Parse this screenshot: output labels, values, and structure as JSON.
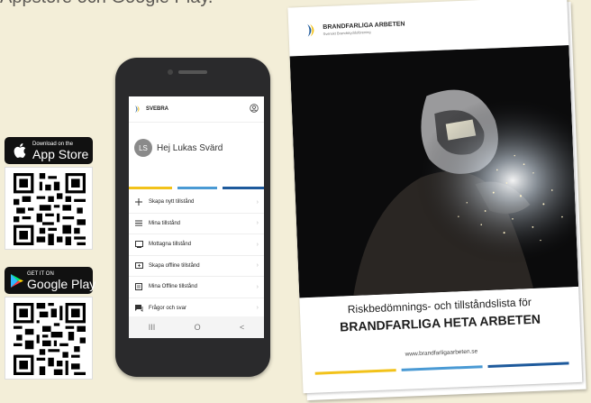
{
  "headline": "Appstore och Google Play.",
  "app_store_badge": {
    "small": "Download on the",
    "big": "App Store"
  },
  "google_play_badge": {
    "small": "GET IT ON",
    "big": "Google Play"
  },
  "phone": {
    "brand": "SVEBRA",
    "avatar_initials": "LS",
    "greeting": "Hej Lukas Svärd",
    "menu": [
      {
        "icon": "plus-icon",
        "label": "Skapa nytt tillstånd"
      },
      {
        "icon": "list-icon",
        "label": "Mina tillstånd"
      },
      {
        "icon": "inbox-icon",
        "label": "Mottagna tillstånd"
      },
      {
        "icon": "offline-icon",
        "label": "Skapa offline tillstånd"
      },
      {
        "icon": "offline-list-icon",
        "label": "Mina Offline tillstånd"
      },
      {
        "icon": "chat-icon",
        "label": "Frågor och svar"
      }
    ],
    "navbar": {
      "recent": "III",
      "home": "O",
      "back": "<"
    }
  },
  "booklet": {
    "title": "BRANDFARLIGA ARBETEN",
    "subtitle": "Svenskt Brandskyddsförening",
    "caption_line1": "Riskbedömnings- och tillståndslista för",
    "caption_line2": "BRANDFARLIGA HETA ARBETEN",
    "url": "www.brandfarligaarbeten.se"
  },
  "colors": {
    "yellow": "#f2c21a",
    "light_blue": "#4a9ad4",
    "dark_blue": "#1e5a9c",
    "background": "#f3eed8"
  }
}
